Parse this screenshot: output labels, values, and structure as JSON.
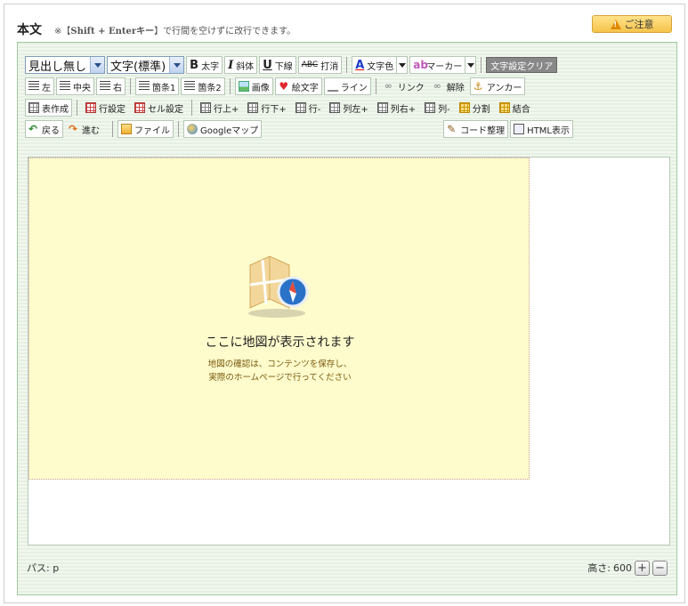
{
  "header": {
    "title": "本文",
    "note_prefix": "※【",
    "note_keys": "Shift + Enterキー",
    "note_suffix": "】で行間を空けずに改行できます。",
    "caution_label": "ご注意"
  },
  "toolbar": {
    "row1": {
      "heading_select": "見出し無し",
      "size_select": "文字(標準)",
      "bold": "太字",
      "italic": "斜体",
      "underline": "下線",
      "strike": "打消",
      "font_color": "文字色",
      "marker": "マーカー",
      "clear": "文字設定クリア"
    },
    "row2": {
      "align_left": "左",
      "align_center": "中央",
      "align_right": "右",
      "list1": "箇条1",
      "list2": "箇条2",
      "image": "画像",
      "emoji": "絵文字",
      "line": "ライン",
      "link": "リンク",
      "unlink": "解除",
      "anchor": "アンカー"
    },
    "row3": {
      "table_create": "表作成",
      "row_settings": "行設定",
      "cell_settings": "セル設定",
      "row_above": "行上+",
      "row_below": "行下+",
      "row_delete": "行-",
      "col_left": "列左+",
      "col_right": "列右+",
      "col_delete": "列-",
      "split": "分割",
      "merge": "結合"
    },
    "row4": {
      "back": "戻る",
      "forward": "進む",
      "file": "ファイル",
      "google_map": "Googleマップ",
      "code_tidy": "コード整理",
      "html_view": "HTML表示"
    }
  },
  "map_placeholder": {
    "main": "ここに地図が表示されます",
    "sub1": "地図の確認は、コンテンツを保存し、",
    "sub2": "実際のホームページで行ってください"
  },
  "footer": {
    "path": "パス: p",
    "height_label": "高さ:",
    "height_value": "600",
    "plus": "+",
    "minus": "−"
  }
}
